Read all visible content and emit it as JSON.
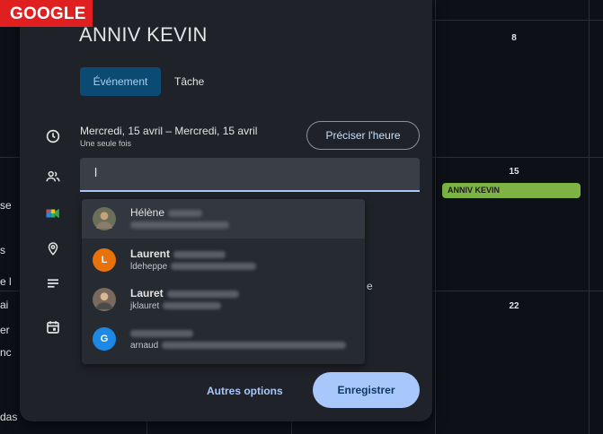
{
  "badge": "GOOGLE",
  "dialog": {
    "title": "ANNIV KEVIN",
    "tabs": [
      {
        "label": "Événement",
        "active": true
      },
      {
        "label": "Tâche",
        "active": false
      }
    ],
    "date_range": "Mercredi, 15 avril  –  Mercredi, 15 avril",
    "repeat": "Une seule fois",
    "precise_time_label": "Préciser l'heure",
    "guest_input_value": "l",
    "suggestions": [
      {
        "name": "Hélène",
        "email_prefix": "",
        "avatar_letter": "",
        "avatar_color": "#6b6f5a"
      },
      {
        "name": "Laurent",
        "email_prefix": "ldeheppe",
        "avatar_letter": "L",
        "avatar_color": "#e8710a"
      },
      {
        "name": "Lauret",
        "email_prefix": "jklauret",
        "avatar_letter": "",
        "avatar_color": "#7a6a5d"
      },
      {
        "name": "",
        "email_prefix": "arnaud",
        "avatar_letter": "G",
        "avatar_color": "#1e88e5"
      }
    ],
    "stray_text": "e",
    "more_options_label": "Autres options",
    "save_label": "Enregistrer",
    "side_icons": [
      "clock-icon",
      "people-icon",
      "meet-icon",
      "location-icon",
      "description-icon",
      "calendar-icon"
    ]
  },
  "calendar": {
    "days": [
      "8",
      "15",
      "22"
    ],
    "event_chip": "ANNIV KEVIN",
    "left_fragments": [
      "se",
      "s",
      "e l",
      "ai",
      "er",
      "nc",
      "das"
    ],
    "colors": {
      "event": "#7cb342",
      "accent": "#a8c7fa"
    }
  }
}
